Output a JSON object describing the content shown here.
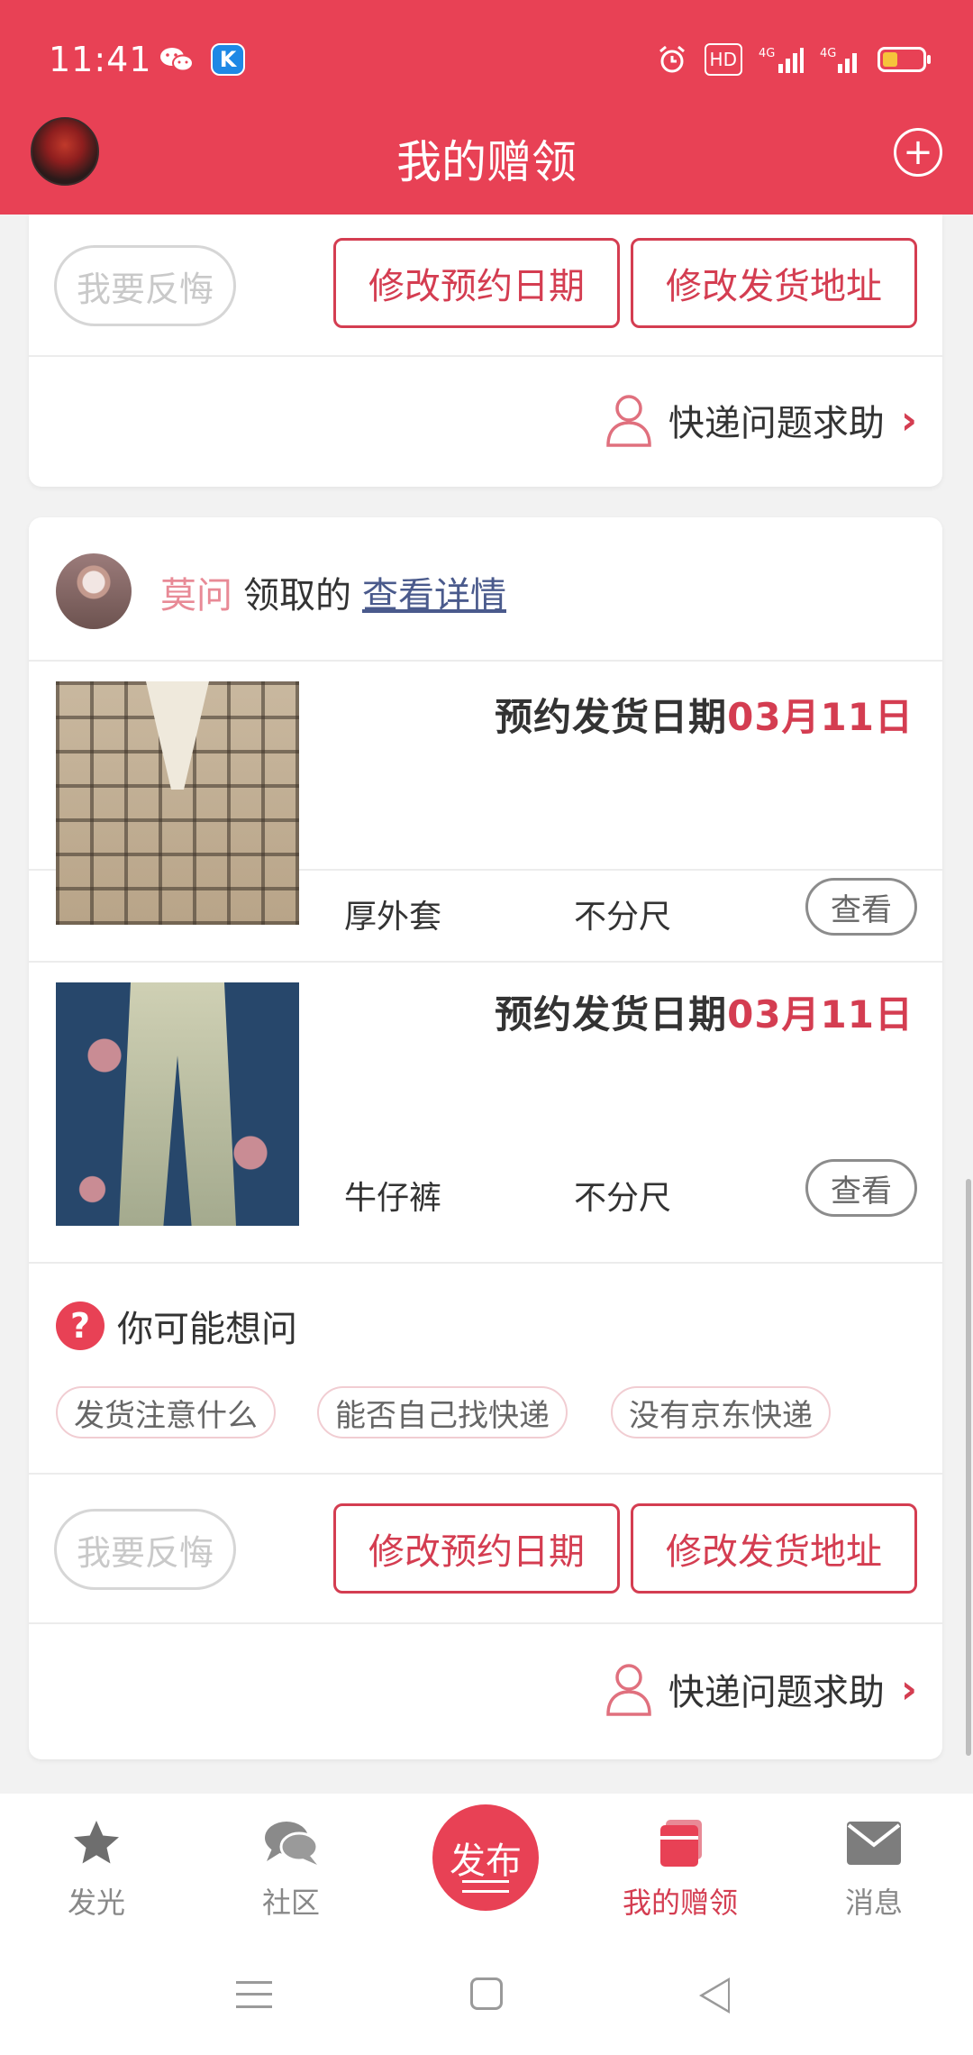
{
  "status_bar": {
    "time": "11:41",
    "left_icons": [
      "wechat-icon",
      "k-app-icon"
    ],
    "right_icons": [
      "alarm-icon",
      "hd-icon",
      "4g-signal-icon",
      "4g-signal-icon",
      "battery-icon"
    ],
    "hd_label": "HD",
    "k_label": "K"
  },
  "app_bar": {
    "title": "我的赠领",
    "add_icon": "plus-circle-icon"
  },
  "colors": {
    "brand_red": "#e84155",
    "accent_red": "#d43d51"
  },
  "card_top": {
    "regret_label": "我要反悔",
    "change_date_label": "修改预约日期",
    "change_address_label": "修改发货地址",
    "express_help_label": "快递问题求助"
  },
  "card_main": {
    "user_name": "莫问",
    "claimed_text": "领取的",
    "view_details": "查看详情",
    "items": [
      {
        "date_prefix": "预约发货日期",
        "date": "03月11日",
        "name": "厚外套",
        "size": "不分尺",
        "view_label": "查看"
      },
      {
        "date_prefix": "预约发货日期",
        "date": "03月11日",
        "name": "牛仔裤",
        "size": "不分尺",
        "view_label": "查看"
      }
    ],
    "faq_title": "你可能想问",
    "faq_tags": [
      "发货注意什么",
      "能否自己找快递",
      "没有京东快递"
    ],
    "regret_label": "我要反悔",
    "change_date_label": "修改预约日期",
    "change_address_label": "修改发货地址",
    "express_help_label": "快递问题求助"
  },
  "bottom_nav": {
    "items": [
      {
        "label": "发光",
        "icon": "star-icon"
      },
      {
        "label": "社区",
        "icon": "chat-bubbles-icon"
      },
      {
        "label": "发布",
        "icon": "publish-icon"
      },
      {
        "label": "我的赠领",
        "icon": "wallet-cards-icon",
        "active": true
      },
      {
        "label": "消息",
        "icon": "mail-icon"
      }
    ]
  }
}
